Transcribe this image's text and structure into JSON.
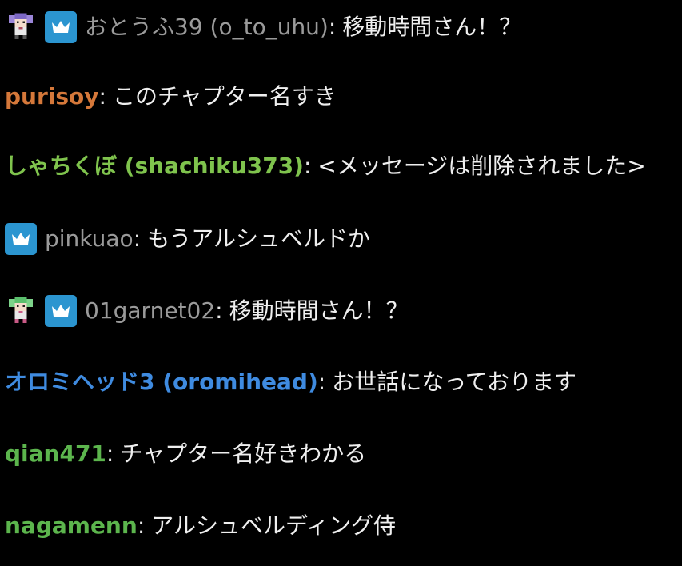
{
  "messages": [
    {
      "badges": [
        "pixel-character-purple-icon",
        "crown-icon"
      ],
      "username": "おとうふ39 (o_to_uhu)",
      "username_color": "#9a9a9a",
      "separator": ":",
      "text": "移動時間さん！？"
    },
    {
      "badges": [],
      "username": "purisoy",
      "username_color": "#d5783a",
      "separator": ":",
      "text": "このチャプター名すき"
    },
    {
      "badges": [],
      "username": "しゃちくぼ (shachiku373)",
      "username_color": "#7fc34d",
      "separator": ":",
      "text": "<メッセージは削除されました>"
    },
    {
      "badges": [
        "crown-icon"
      ],
      "username": "pinkuao",
      "username_color": "#9a9a9a",
      "separator": ":",
      "text": "もうアルシュベルドか"
    },
    {
      "badges": [
        "pixel-character-green-icon",
        "crown-icon"
      ],
      "username": "01garnet02",
      "username_color": "#9a9a9a",
      "separator": ":",
      "text": "移動時間さん！？"
    },
    {
      "badges": [],
      "username": "オロミヘッド3 (oromihead)",
      "username_color": "#3f8be0",
      "separator": ":",
      "text": "お世話になっております"
    },
    {
      "badges": [],
      "username": "qian471",
      "username_color": "#5cb54d",
      "separator": ":",
      "text": "チャプター名好きわかる"
    },
    {
      "badges": [],
      "username": "nagamenn",
      "username_color": "#5cb54d",
      "separator": ":",
      "text": "アルシュベルディング侍"
    }
  ]
}
